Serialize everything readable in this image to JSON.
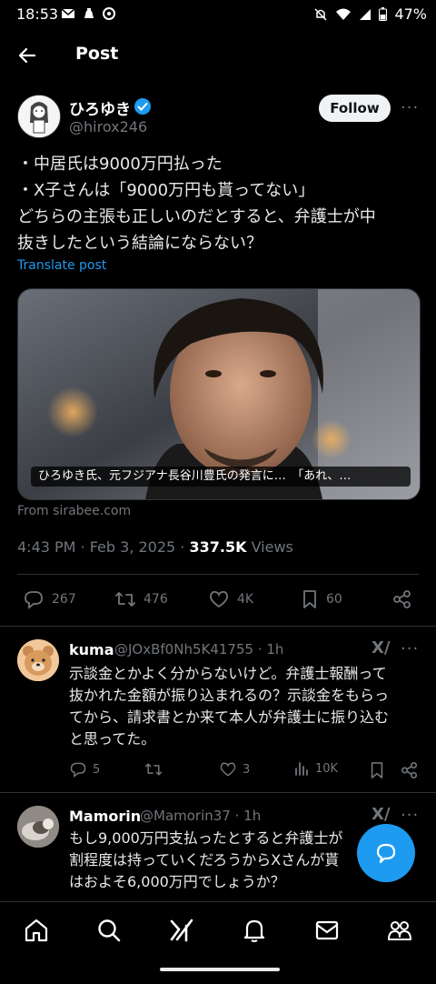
{
  "status_bar": {
    "time": "18:53",
    "battery": "47%"
  },
  "header": {
    "title": "Post"
  },
  "post": {
    "author_name": "ひろゆき",
    "author_handle": "@hirox246",
    "follow_label": "Follow",
    "lines": [
      "・中居氏は9000万円払った",
      "・X子さんは「9000万円も貰ってない」",
      "どちらの主張も正しいのだとすると、弁護士が中",
      "抜きしたという結論にならない？"
    ],
    "translate_label": "Translate post",
    "card_caption": "ひろゆき氏、元フジアナ長谷川豊氏の発言に…　「あれ、…",
    "card_source": "From sirabee.com",
    "time": "4:43 PM · Feb 3, 2025 · ",
    "views_count": "337.5K",
    "views_label": " Views",
    "stats": {
      "replies": "267",
      "reposts": "476",
      "likes": "4K",
      "bookmarks": "60"
    }
  },
  "replies": [
    {
      "name": "kuma",
      "handle": "@JOxBf0Nh5K41755 · 1h",
      "lines": [
        "示談金とかよく分からないけど。弁護士報酬って",
        "抜かれた金額が振り込まれるの？示談金をもらっ",
        "てから、請求書とか来て本人が弁護士に振り込む",
        "と思ってた。"
      ],
      "stats": {
        "replies": "5",
        "reposts": "",
        "likes": "3",
        "views": "10K"
      }
    },
    {
      "name": "Mamorin",
      "handle": "@Mamorin37 · 1h",
      "lines": [
        "もし9,000万円支払ったとすると弁護士が",
        "割程度は持っていくだろうからXさんが貰",
        "はおよそ6,000万円でしょうか？"
      ]
    }
  ],
  "colors": {
    "accent": "#1d9bf0",
    "background": "#000000",
    "muted": "#71767b"
  }
}
